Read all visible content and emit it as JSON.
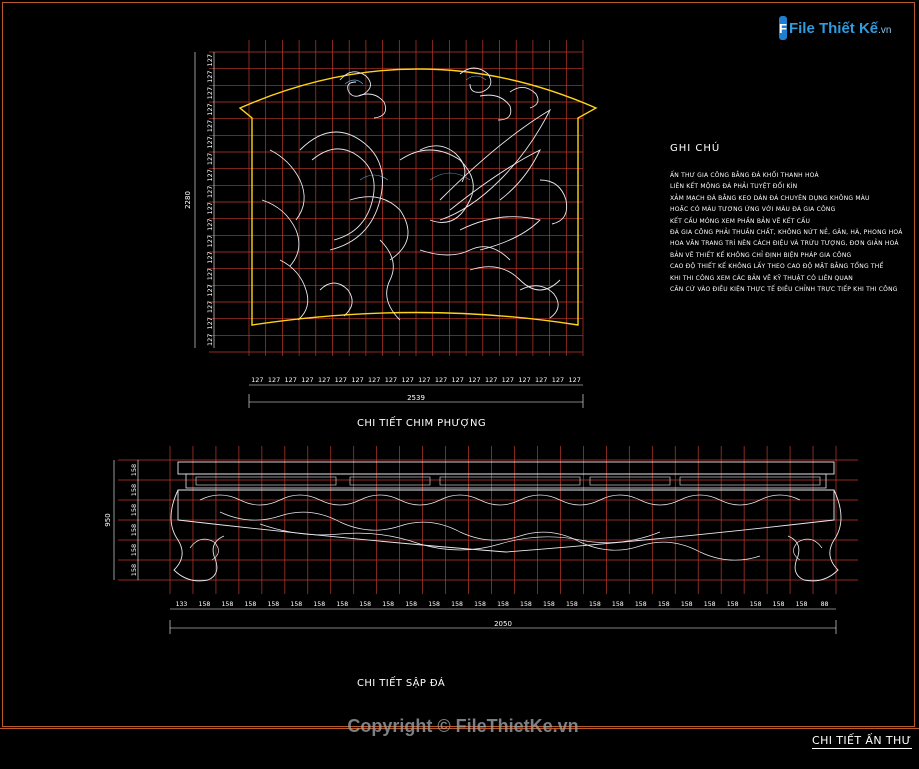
{
  "logo": {
    "box_letter": "F",
    "text": "File Thiết Kế",
    "suffix": ".vn"
  },
  "notes": {
    "title": "GHI CHÚ",
    "lines": [
      "ẤN THƯ GIA CÔNG BẰNG ĐÁ KHỐI THANH HOÁ",
      "LIÊN KẾT MỘNG ĐÁ PHẢI TUYỆT ĐỐI KÍN",
      "XẢM MẠCH ĐÁ BẰNG KEO DÁN ĐÁ CHUYÊN DỤNG KHÔNG MÀU",
      "HOẶC CÓ MÀU TƯƠNG ỨNG VỚI MÀU ĐÁ GIA CÔNG",
      "KẾT CẤU MÓNG XEM PHẦN BẢN VẼ KẾT CẤU",
      "ĐÁ GIA CÔNG PHẢI THUẦN CHẤT, KHÔNG NỨT NẺ, GÂN, HÀ, PHONG HOÁ",
      "HOA VĂN TRANG TRÍ NÊN CÁCH ĐIỆU VÀ TRỪU TƯỢNG, ĐƠN GIẢN HOÁ",
      "BẢN VẼ THIẾT KẾ KHÔNG CHỈ ĐỊNH BIỆN PHÁP GIA CÔNG",
      "CAO ĐỘ THIẾT KẾ KHÔNG LẤY THEO CAO ĐỘ MẶT BẰNG TỔNG THỂ",
      "KHI THI CÔNG XEM CÁC BẢN VẼ KỸ THUẬT CÓ LIÊN QUAN",
      "CĂN CỨ VÀO ĐIỀU KIỆN THỰC TẾ ĐIỀU CHỈNH TRỰC TIẾP KHI THI CÔNG"
    ]
  },
  "phoenix": {
    "caption": "CHI TIẾT CHIM PHƯỢNG",
    "height_total": "2280",
    "width_total": "2539",
    "module": "127",
    "rows": 18,
    "cols": 20
  },
  "bed": {
    "caption": "CHI TIẾT SẬP ĐÁ",
    "height_total": "950",
    "width_total": "2050",
    "v_module": "158",
    "v_rows": 6,
    "h_labels": [
      "133",
      "158",
      "158",
      "158",
      "158",
      "158",
      "158",
      "158",
      "158",
      "158",
      "158",
      "158",
      "158",
      "158",
      "158",
      "158",
      "158",
      "158",
      "158",
      "158",
      "158",
      "158",
      "158",
      "158",
      "158",
      "158",
      "158",
      "158",
      "88"
    ]
  },
  "sheet_title": "CHI TIẾT ẤN THƯ",
  "copyright": "Copyright © FileThietKe.vn",
  "colors": {
    "grid": "#c0392b",
    "frame": "#b85a2a",
    "carving": "#e8e8f0",
    "outline": "#ffd21a"
  }
}
